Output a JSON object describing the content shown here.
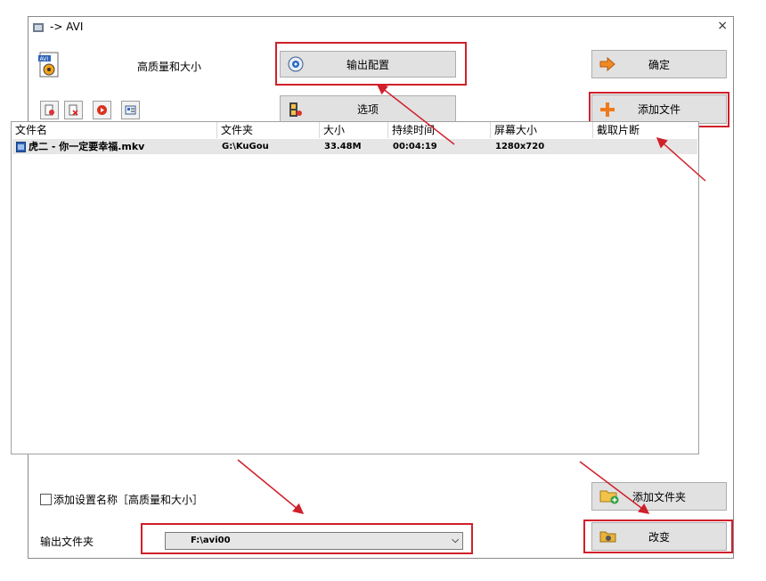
{
  "window": {
    "title": "-> AVI",
    "close_glyph": "×"
  },
  "profile": {
    "label": "高质量和大小",
    "icon": "avi-file-icon"
  },
  "buttons": {
    "output_config": "输出配置",
    "options": "选项",
    "ok": "确定",
    "add_file": "添加文件",
    "add_folder": "添加文件夹",
    "change": "改变"
  },
  "table": {
    "columns": [
      "文件名",
      "文件夹",
      "大小",
      "持续时间",
      "屏幕大小",
      "截取片断"
    ],
    "rows": [
      {
        "name": "虎二 - 你一定要幸福.mkv",
        "folder": "G:\\KuGou",
        "size": "33.48M",
        "duration": "00:04:19",
        "screen": "1280x720",
        "clip": ""
      }
    ]
  },
  "add_setting_name": {
    "label": "添加设置名称［高质量和大小］",
    "checked": false
  },
  "output_folder": {
    "label": "输出文件夹",
    "value": "F:\\avi00"
  },
  "colors": {
    "highlight": "#d0202a",
    "button": "#e1e1e1"
  }
}
